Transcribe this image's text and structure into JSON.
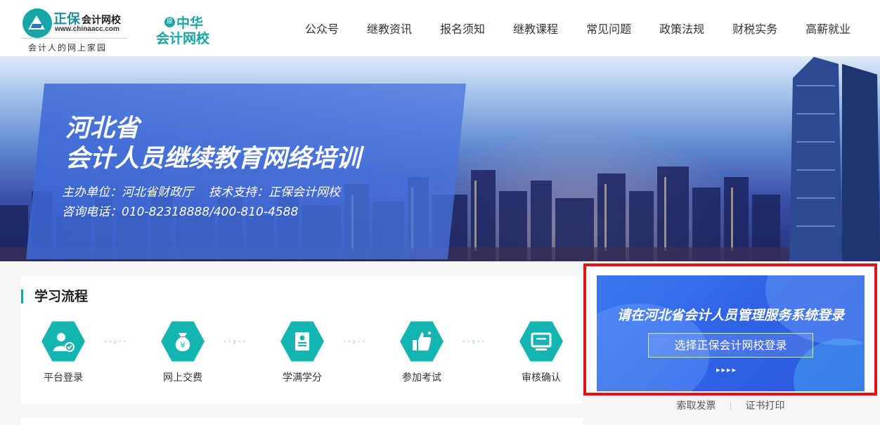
{
  "header": {
    "logo": {
      "name": "正保",
      "name_sub": "会计网校",
      "url": "www.chinaacc.com",
      "slogan": "会计人的网上家园"
    },
    "brand2": {
      "badge": "原",
      "line1": "中华",
      "line2": "会计网校"
    },
    "nav": [
      "公众号",
      "继教资讯",
      "报名须知",
      "继教课程",
      "常见问题",
      "政策法规",
      "财税实务",
      "高薪就业"
    ]
  },
  "banner": {
    "title_line1": "河北省",
    "title_line2": "会计人员继续教育网络培训",
    "organizer": "主办单位：河北省财政厅",
    "tech_support": "技术支持：正保会计网校",
    "hotline": "咨询电话：010-82318888/400-810-4588"
  },
  "flow": {
    "title": "学习流程",
    "steps": [
      {
        "label": "平台登录",
        "icon": "user-login-icon"
      },
      {
        "label": "网上交费",
        "icon": "money-bag-icon"
      },
      {
        "label": "学满学分",
        "icon": "certificate-icon"
      },
      {
        "label": "参加考试",
        "icon": "thumbs-up-icon"
      },
      {
        "label": "审核确认",
        "icon": "monitor-icon"
      }
    ],
    "arrow": "··›··"
  },
  "login": {
    "title": "请在河北省会计人员管理服务系统登录",
    "button": "选择正保会计网校登录",
    "arrows": "▸▸▸▸",
    "links": [
      "索取发票",
      "证书打印"
    ]
  },
  "colors": {
    "accent": "#17a6a0",
    "login_blue": "#2f62e6",
    "highlight_red": "#e01313"
  }
}
